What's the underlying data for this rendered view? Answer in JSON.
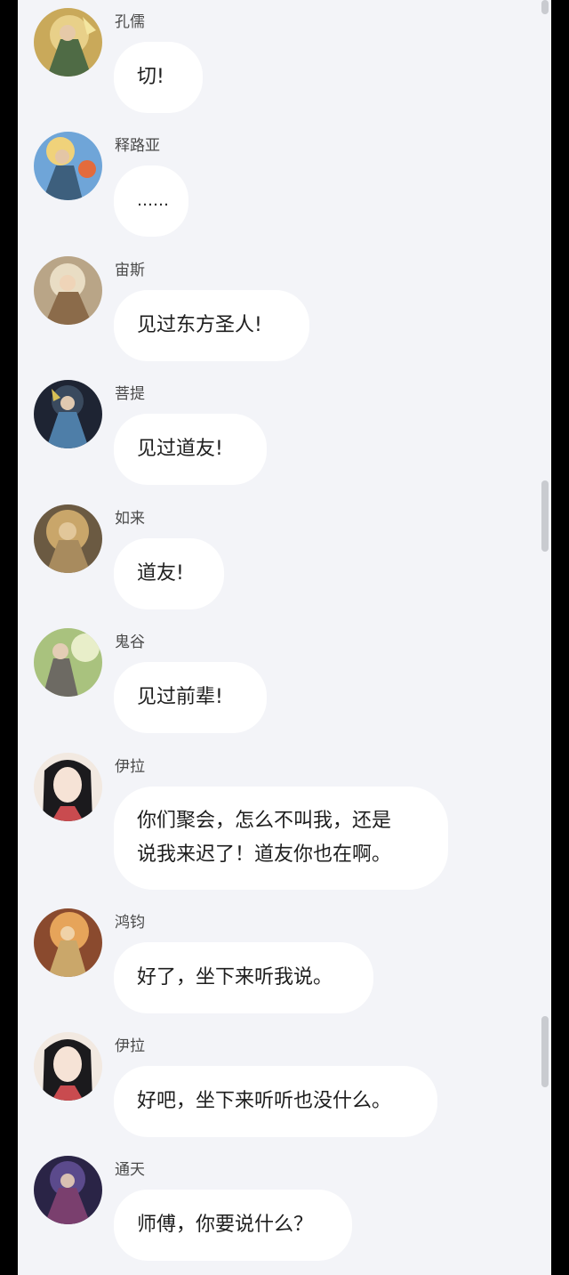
{
  "messages": [
    {
      "name": "孔儒",
      "text": "切!"
    },
    {
      "name": "释路亚",
      "text": "……"
    },
    {
      "name": "宙斯",
      "text": "见过东方圣人!"
    },
    {
      "name": "菩提",
      "text": "见过道友!"
    },
    {
      "name": "如来",
      "text": "道友!"
    },
    {
      "name": "鬼谷",
      "text": "见过前辈!"
    },
    {
      "name": "伊拉",
      "text_line1": "你们聚会，怎么不叫我，还是",
      "text_line2": "说我来迟了！道友你也在啊。"
    },
    {
      "name": "鸿钧",
      "text": "好了，坐下来听我说。"
    },
    {
      "name": "伊拉",
      "text": "好吧，坐下来听听也没什么。"
    },
    {
      "name": "通天",
      "text": "师傅，你要说什么？"
    }
  ],
  "colors": {
    "background": "#f3f4f8",
    "bubble": "#ffffff",
    "name_text": "#4a4a4a",
    "message_text": "#1e1e1e"
  }
}
